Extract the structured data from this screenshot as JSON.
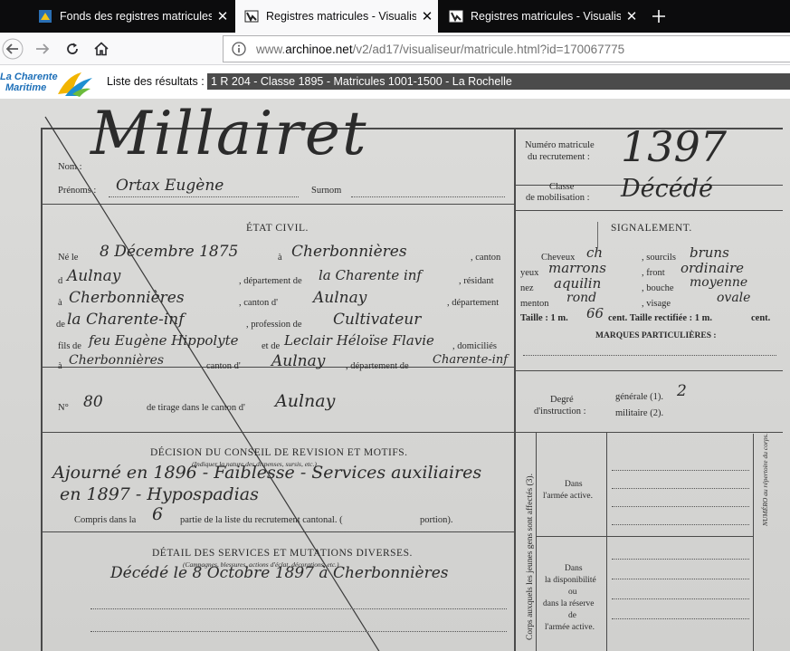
{
  "tabs": [
    {
      "title": "Fonds des registres matricules",
      "active": false
    },
    {
      "title": "Registres matricules - Visualiseur",
      "active": true
    },
    {
      "title": "Registres matricules - Visualiseur",
      "active": false
    }
  ],
  "nav": {
    "url_prefix": "www.",
    "url_host": "archinoe.net",
    "url_path": "/v2/ad17/visualiseur/matricule.html?id=170067775"
  },
  "site": {
    "logo_line1": "La Charente",
    "logo_line2": "Maritime",
    "results_label": "Liste des résultats :",
    "results_value": "1 R 204 - Classe 1895 - Matricules 1001-1500 - La Rochelle"
  },
  "document": {
    "surname_hand": "Millairet",
    "matricule_hand": "1397",
    "classe_hand": "Décédé",
    "prenoms_hand": "Ortax Eugène",
    "labels": {
      "nom": "Nom :",
      "prenoms": "Prénoms :",
      "surnom": "Surnom",
      "numero_matricule_1": "Numéro matricule",
      "numero_matricule_2": "du recrutement :",
      "classe_1": "Classe",
      "classe_2": "de mobilisation :",
      "etat_civil": "ÉTAT CIVIL.",
      "signalement": "SIGNALEMENT.",
      "ne_le": "Né le",
      "a": "à",
      "canton": ", canton",
      "d": "d",
      "departement_de": ", département de",
      "residant": ", résidant",
      "canton_d": ", canton d'",
      "departement": ", département",
      "de": "de",
      "profession_de": ", profession de",
      "fils_de": "fils de",
      "et_de": "et de",
      "domicilies": ", domiciliés",
      "canton_d2": "canton d'",
      "departement_de2": ", département de",
      "cheveux": "Cheveux",
      "sourcils": ", sourcils",
      "yeux": "yeux",
      "front": ", front",
      "nez": "nez",
      "bouche": ", bouche",
      "menton": "menton",
      "visage": ", visage",
      "taille": "Taille : 1 m.",
      "taille_rect": "cent. Taille rectifiée : 1 m.",
      "cent": "cent.",
      "marques": "MARQUES PARTICULIÈRES :",
      "no": "N°",
      "tirage": "de tirage dans le canton d'",
      "degre1": "Degré",
      "degre2": "d'instruction :",
      "generale": "générale (1).",
      "militaire": "militaire (2).",
      "decision": "DÉCISION DU CONSEIL DE REVISION ET MOTIFS.",
      "decision_sub": "(Indiquer la nature des dispenses, sursis, etc.)",
      "compris": "Compris dans la",
      "partie": "partie de la liste du recrutement cantonal. (",
      "portion": "portion).",
      "detail": "DÉTAIL DES SERVICES ET MUTATIONS DIVERSES.",
      "detail_sub": "(Campagnes, blessures, actions d'éclat, décorations, etc.)",
      "dans1": "Dans",
      "armee_active": "l'armée active.",
      "dans2": "Dans",
      "la_dispo": "la disponibilité",
      "ou": "ou",
      "reserve": "dans la réserve",
      "de_armee": "de",
      "armee_active2": "l'armée active.",
      "vertical_label": "Corps auxquels les jeunes gens sont affectés (3).",
      "numero_repertoire": "NUMÉRO au répertoire du corps."
    },
    "handwriting": {
      "date": "8 Décembre 1875",
      "birthplace": "Cherbonnières",
      "canton": "Aulnay",
      "departement": "la Charente inf",
      "residence": "Cherbonnières",
      "canton2": "Aulnay",
      "departement2": "la Charente-inf",
      "profession": "Cultivateur",
      "father": "feu Eugène Hippolyte",
      "mother": "Leclair Héloïse Flavie",
      "domicile": "Cherbonnières",
      "canton3": "Aulnay",
      "departement3": "Charente-inf",
      "cheveux": "ch",
      "sourcils": "bruns",
      "yeux": "marrons",
      "front": "ordinaire",
      "nez": "aquilin",
      "bouche": "moyenne",
      "menton": "rond",
      "visage": "ovale",
      "taille_cm": "66",
      "tirage_no": "80",
      "tirage_canton": "Aulnay",
      "instruction": "2",
      "decision_1": "Ajourné en 1896 - Faiblesse - Services auxiliaires",
      "decision_2": "en 1897 - Hypospadias",
      "partie": "6",
      "detail_1": "Décédé le 8 Octobre 1897 à Cherbonnières"
    }
  }
}
